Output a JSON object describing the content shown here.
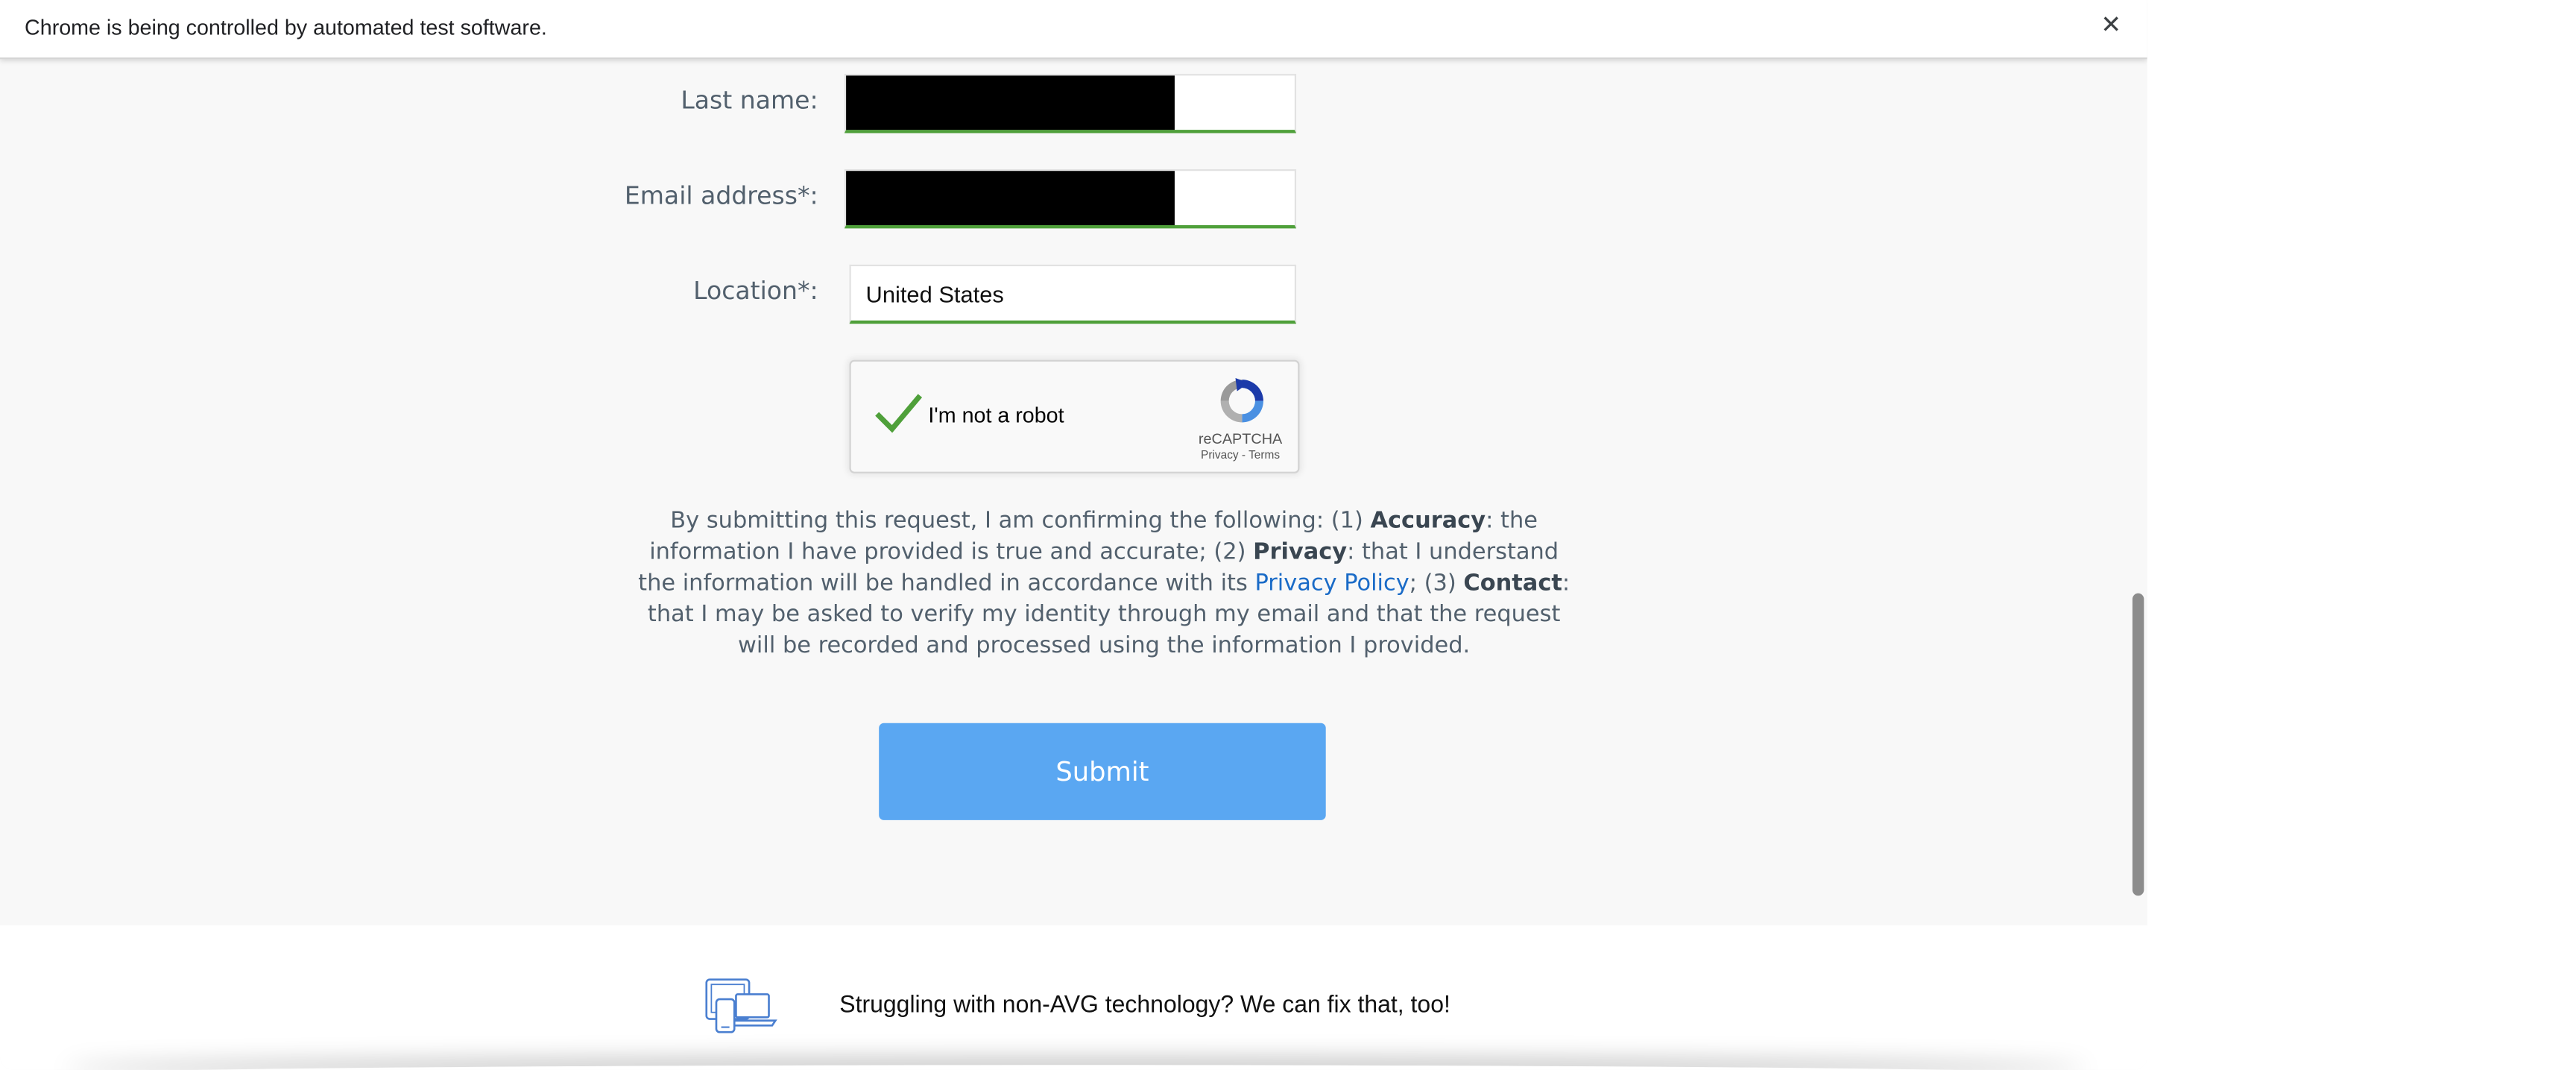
{
  "infobar": {
    "message": "Chrome is being controlled by automated test software.",
    "close_glyph": "✕"
  },
  "form": {
    "last_name_label": "Last name:",
    "email_label": "Email address*:",
    "location_label": "Location*:",
    "location_value": "United States",
    "last_name_value_redacted": true,
    "email_value_redacted": true,
    "field_valid_color": "#4fa03a"
  },
  "captcha": {
    "label": "I'm not a robot",
    "brand": "reCAPTCHA",
    "links": "Privacy - Terms",
    "checked": true,
    "check_color": "#4fa03a"
  },
  "consent": {
    "intro": "By submitting this request, I am confirming the following: (1) ",
    "accuracy_label": "Accuracy",
    "accuracy_text": ": the information I have provided is true and accurate; (2) ",
    "privacy_label": "Privacy",
    "privacy_text": ": that I understand the information will be handled in accordance with its ",
    "privacy_link": "Privacy Policy",
    "sep": "; (3) ",
    "contact_label": "Contact",
    "contact_text": ": that I may be asked to verify my identity through my email and that the request will be recorded and processed using the information I provided."
  },
  "submit": {
    "label": "Submit",
    "color": "#5aa7f2"
  },
  "footer": {
    "text": "Struggling with non-AVG technology? We can fix that, too!",
    "icon": "devices-icon"
  }
}
